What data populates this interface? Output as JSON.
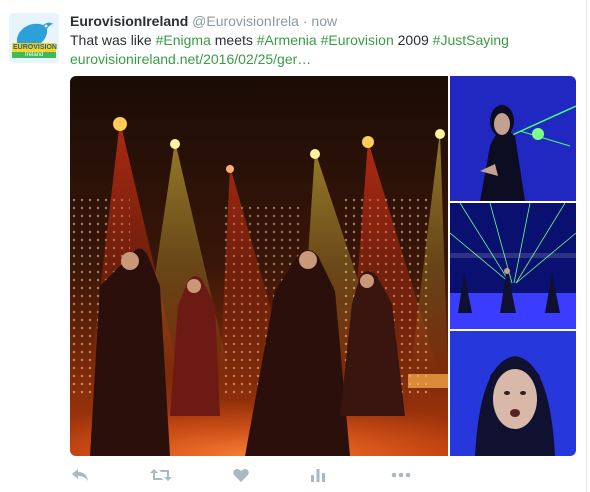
{
  "tweet": {
    "author_name": "EurovisionIreland",
    "author_handle": "@EurovisionIrela",
    "separator": "·",
    "timestamp": "now",
    "text_parts": {
      "p1": "That was like ",
      "h1": "#Enigma",
      "p2": " meets ",
      "h2": "#Armenia",
      "p3": " ",
      "h3": "#Eurovision",
      "p4": " 2009 ",
      "h4": "#JustSaying"
    },
    "link_text": "eurovisionireland.net/2016/02/25/ger…"
  },
  "avatar": {
    "icon": "bird-icon",
    "brand_text": "EUROVISION",
    "brand_subtext": "Ireland"
  },
  "actions": [
    {
      "name": "reply",
      "icon": "reply-icon"
    },
    {
      "name": "retweet",
      "icon": "retweet-icon"
    },
    {
      "name": "like",
      "icon": "heart-icon"
    },
    {
      "name": "analytics",
      "icon": "bar-chart-icon"
    },
    {
      "name": "more",
      "icon": "more-icon"
    }
  ],
  "colors": {
    "hashtag": "#3b9b45",
    "name": "#292f33",
    "muted": "#8899a6",
    "action_icon": "#aab8c2",
    "stage_blue": "#1a2ccf"
  }
}
